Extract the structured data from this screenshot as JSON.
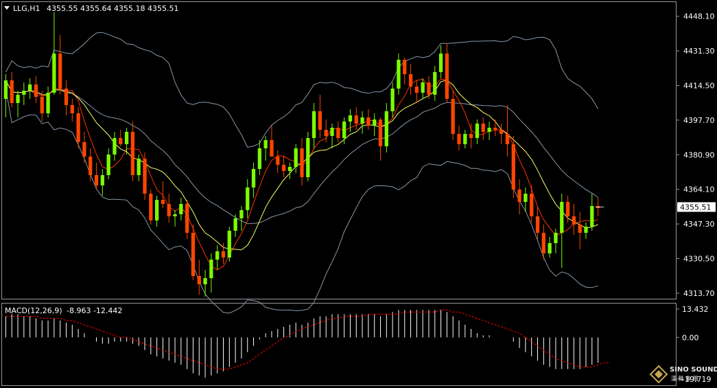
{
  "header": {
    "symbol": "LLG,H1",
    "ohlc": "4355.55 4355.64 4355.18 4355.51"
  },
  "macd_header": {
    "label": "MACD(12,26,9)",
    "values": "-8.963 -12.442"
  },
  "price_axis": {
    "ticks": [
      "4448.10",
      "4431.30",
      "4414.50",
      "4397.70",
      "4380.90",
      "4364.10",
      "4347.30",
      "4330.50",
      "4313.70"
    ],
    "current": "4355.51"
  },
  "macd_axis": {
    "ticks": [
      "13.432",
      "0.00",
      "-19.719"
    ]
  },
  "watermark": {
    "brand": "SINO SOUND",
    "sub": "漢 聲 集 團"
  },
  "colors": {
    "background": "#000000",
    "bull": "#7CFC00",
    "bear": "#FF4500",
    "bands": "#8899AA",
    "ma_fast": "#FF3300",
    "ma_slow": "#FFFF66",
    "macd_hist": "#FFFFFF",
    "macd_signal": "#FF0000"
  },
  "chart_data": {
    "type": "candlestick",
    "title": "LLG,H1",
    "ylim": [
      4311,
      4455
    ],
    "candles": [
      [
        4408,
        4420,
        4399,
        4417
      ],
      [
        4417,
        4421,
        4404,
        4406
      ],
      [
        4406,
        4412,
        4399,
        4410
      ],
      [
        4410,
        4416,
        4405,
        4412
      ],
      [
        4412,
        4418,
        4408,
        4415
      ],
      [
        4415,
        4419,
        4406,
        4409
      ],
      [
        4409,
        4412,
        4397,
        4401
      ],
      [
        4401,
        4414,
        4399,
        4411
      ],
      [
        4411,
        4450,
        4410,
        4430
      ],
      [
        4430,
        4439,
        4410,
        4413
      ],
      [
        4413,
        4417,
        4400,
        4405
      ],
      [
        4405,
        4408,
        4397,
        4401
      ],
      [
        4401,
        4404,
        4384,
        4387
      ],
      [
        4387,
        4392,
        4377,
        4380
      ],
      [
        4380,
        4384,
        4368,
        4371
      ],
      [
        4371,
        4377,
        4364,
        4366
      ],
      [
        4366,
        4374,
        4361,
        4371
      ],
      [
        4371,
        4384,
        4369,
        4381
      ],
      [
        4381,
        4392,
        4378,
        4389
      ],
      [
        4389,
        4393,
        4385,
        4386
      ],
      [
        4386,
        4394,
        4381,
        4392
      ],
      [
        4392,
        4397,
        4368,
        4371
      ],
      [
        4371,
        4381,
        4368,
        4379
      ],
      [
        4379,
        4382,
        4359,
        4362
      ],
      [
        4362,
        4364,
        4347,
        4349
      ],
      [
        4349,
        4361,
        4346,
        4359
      ],
      [
        4359,
        4368,
        4355,
        4357
      ],
      [
        4357,
        4362,
        4348,
        4351
      ],
      [
        4351,
        4354,
        4346,
        4352
      ],
      [
        4352,
        4360,
        4349,
        4357
      ],
      [
        4357,
        4359,
        4340,
        4343
      ],
      [
        4343,
        4347,
        4320,
        4322
      ],
      [
        4322,
        4330,
        4313,
        4318
      ],
      [
        4318,
        4325,
        4312,
        4321
      ],
      [
        4321,
        4333,
        4314,
        4330
      ],
      [
        4330,
        4337,
        4325,
        4334
      ],
      [
        4334,
        4338,
        4328,
        4331
      ],
      [
        4331,
        4346,
        4329,
        4344
      ],
      [
        4344,
        4352,
        4341,
        4350
      ],
      [
        4350,
        4356,
        4344,
        4354
      ],
      [
        4354,
        4369,
        4350,
        4365
      ],
      [
        4365,
        4377,
        4360,
        4374
      ],
      [
        4374,
        4388,
        4371,
        4384
      ],
      [
        4384,
        4390,
        4378,
        4388
      ],
      [
        4388,
        4395,
        4383,
        4380
      ],
      [
        4380,
        4383,
        4372,
        4376
      ],
      [
        4376,
        4380,
        4370,
        4373
      ],
      [
        4373,
        4377,
        4369,
        4375
      ],
      [
        4375,
        4386,
        4372,
        4384
      ],
      [
        4384,
        4389,
        4366,
        4370
      ],
      [
        4370,
        4392,
        4368,
        4389
      ],
      [
        4389,
        4406,
        4384,
        4402
      ],
      [
        4402,
        4410,
        4389,
        4393
      ],
      [
        4393,
        4398,
        4387,
        4390
      ],
      [
        4390,
        4396,
        4384,
        4394
      ],
      [
        4394,
        4397,
        4387,
        4389
      ],
      [
        4389,
        4399,
        4386,
        4397
      ],
      [
        4397,
        4403,
        4392,
        4400
      ],
      [
        4400,
        4404,
        4393,
        4396
      ],
      [
        4396,
        4402,
        4391,
        4399
      ],
      [
        4399,
        4403,
        4393,
        4395
      ],
      [
        4395,
        4401,
        4390,
        4398
      ],
      [
        4398,
        4399,
        4378,
        4385
      ],
      [
        4385,
        4406,
        4382,
        4402
      ],
      [
        4402,
        4416,
        4399,
        4413
      ],
      [
        4413,
        4430,
        4410,
        4427
      ],
      [
        4427,
        4428,
        4415,
        4420
      ],
      [
        4420,
        4425,
        4410,
        4414
      ],
      [
        4414,
        4417,
        4406,
        4411
      ],
      [
        4411,
        4418,
        4408,
        4416
      ],
      [
        4416,
        4419,
        4408,
        4410
      ],
      [
        4410,
        4424,
        4407,
        4421
      ],
      [
        4421,
        4434,
        4418,
        4430
      ],
      [
        4430,
        4435,
        4406,
        4408
      ],
      [
        4408,
        4412,
        4388,
        4391
      ],
      [
        4391,
        4395,
        4383,
        4386
      ],
      [
        4386,
        4393,
        4384,
        4391
      ],
      [
        4391,
        4396,
        4384,
        4389
      ],
      [
        4389,
        4398,
        4386,
        4396
      ],
      [
        4396,
        4399,
        4388,
        4392
      ],
      [
        4392,
        4397,
        4388,
        4394
      ],
      [
        4394,
        4398,
        4390,
        4393
      ],
      [
        4393,
        4396,
        4386,
        4391
      ],
      [
        4391,
        4405,
        4380,
        4386
      ],
      [
        4386,
        4390,
        4360,
        4364
      ],
      [
        4364,
        4369,
        4352,
        4358
      ],
      [
        4358,
        4365,
        4353,
        4362
      ],
      [
        4362,
        4366,
        4348,
        4351
      ],
      [
        4351,
        4356,
        4340,
        4343
      ],
      [
        4343,
        4347,
        4330,
        4333
      ],
      [
        4333,
        4341,
        4331,
        4338
      ],
      [
        4338,
        4345,
        4333,
        4343
      ],
      [
        4343,
        4362,
        4326,
        4358
      ],
      [
        4358,
        4361,
        4348,
        4351
      ],
      [
        4351,
        4357,
        4342,
        4347
      ],
      [
        4347,
        4353,
        4335,
        4343
      ],
      [
        4343,
        4348,
        4340,
        4346
      ],
      [
        4346,
        4362,
        4344,
        4356
      ],
      [
        4356,
        4360,
        4351,
        4355
      ]
    ],
    "macd": [
      10,
      11,
      11,
      10,
      10,
      9,
      8,
      8,
      9,
      8,
      7,
      6,
      4,
      2,
      0,
      -2,
      -3,
      -3,
      -2,
      -2,
      -2,
      -3,
      -4,
      -6,
      -8,
      -9,
      -10,
      -11,
      -12,
      -13,
      -15,
      -17,
      -18,
      -19,
      -18,
      -17,
      -16,
      -14,
      -12,
      -10,
      -7,
      -4,
      -1,
      2,
      3,
      4,
      5,
      6,
      7,
      6,
      7,
      9,
      10,
      10,
      11,
      11,
      11,
      11,
      11,
      11,
      11,
      11,
      10,
      11,
      12,
      13,
      13,
      13,
      13,
      13,
      13,
      13,
      13,
      12,
      10,
      8,
      6,
      4,
      2,
      1,
      1,
      0,
      0,
      0,
      -2,
      -5,
      -7,
      -9,
      -11,
      -13,
      -14,
      -15,
      -15,
      -15,
      -15,
      -15,
      -14,
      -13,
      -12
    ],
    "signal": [
      10,
      10,
      10,
      10,
      10,
      10,
      9,
      9,
      9,
      9,
      8,
      8,
      7,
      6,
      5,
      4,
      3,
      2,
      1,
      0,
      0,
      -1,
      -2,
      -3,
      -4,
      -5,
      -6,
      -7,
      -8,
      -9,
      -10,
      -11,
      -12,
      -13,
      -14,
      -15,
      -15,
      -15,
      -14,
      -13,
      -12,
      -10,
      -8,
      -6,
      -4,
      -2,
      0,
      1,
      3,
      4,
      5,
      6,
      7,
      8,
      9,
      9,
      10,
      10,
      10,
      10,
      11,
      11,
      11,
      11,
      11,
      11,
      12,
      12,
      12,
      12,
      12,
      12,
      13,
      13,
      12,
      12,
      11,
      10,
      9,
      8,
      7,
      6,
      5,
      4,
      3,
      2,
      0,
      -2,
      -4,
      -6,
      -8,
      -10,
      -11,
      -12,
      -13,
      -14,
      -14,
      -14,
      -13,
      -12,
      -12
    ],
    "macd_ylim": [
      -19.719,
      13.432
    ],
    "series": [
      {
        "name": "MACD(12,26,9)"
      }
    ]
  }
}
